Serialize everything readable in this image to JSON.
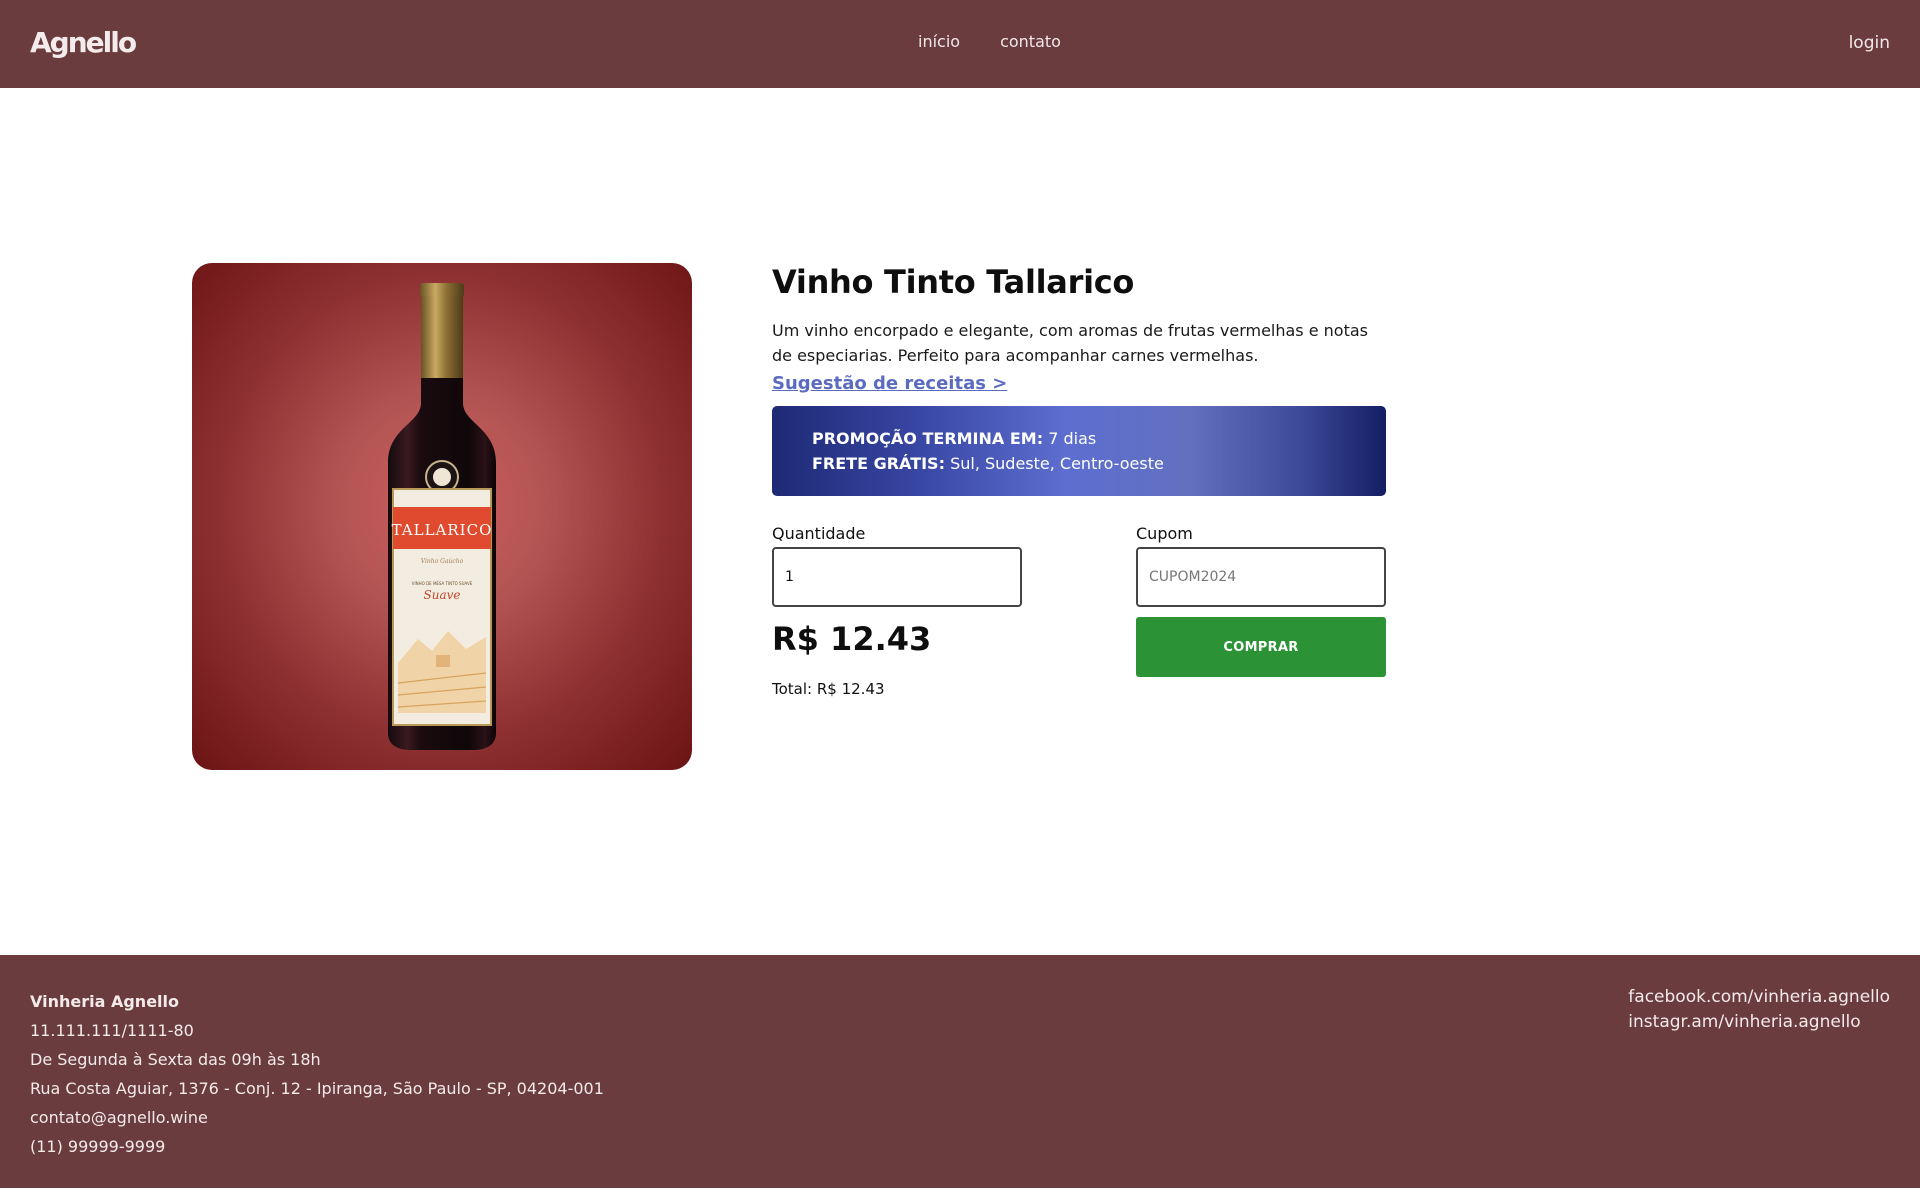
{
  "header": {
    "logo": "Agnello",
    "nav": [
      {
        "label": "início"
      },
      {
        "label": "contato"
      }
    ],
    "login_label": "login"
  },
  "product": {
    "image_alt": "Garrafa Tallarico Suave",
    "bottle_label": {
      "brand": "TALLARICO",
      "sub": "Vinho Gaúcho",
      "small": "VINHO DE MESA TINTO SUAVE",
      "style": "Suave"
    },
    "title": "Vinho Tinto Tallarico",
    "description": "Um vinho encorpado e elegante, com aromas de frutas vermelhas e notas de especiarias. Perfeito para acompanhar carnes vermelhas.",
    "recipes_link": "Sugestão de receitas >",
    "promo": {
      "ends_label": "PROMOÇÃO TERMINA EM:",
      "ends_value": "7 dias",
      "shipping_label": "FRETE GRÁTIS:",
      "shipping_value": "Sul, Sudeste, Centro-oeste"
    },
    "quantity": {
      "label": "Quantidade",
      "value": "1"
    },
    "coupon": {
      "label": "Cupom",
      "placeholder": "CUPOM2024"
    },
    "price": "R$ 12.43",
    "total": "Total: R$ 12.43",
    "buy_label": "COMPRAR"
  },
  "footer": {
    "company": "Vinheria Agnello",
    "cnpj": "11.111.111/1111-80",
    "hours": "De Segunda à Sexta das 09h às 18h",
    "address": "Rua Costa Aguiar, 1376 - Conj. 12 - Ipiranga, São Paulo - SP, 04204-001",
    "email": "contato@agnello.wine",
    "phone": "(11) 99999-9999",
    "social": [
      {
        "label": "facebook.com/vinheria.agnello"
      },
      {
        "label": "instagr.am/vinheria.agnello"
      }
    ]
  },
  "colors": {
    "header_bg": "#6b3c3d",
    "footer_bg": "#6b3c3d",
    "link": "#5b6bbf",
    "buy_button": "#2b9236",
    "promo_from": "#1e2a75",
    "promo_mid": "#5d6ed0"
  }
}
